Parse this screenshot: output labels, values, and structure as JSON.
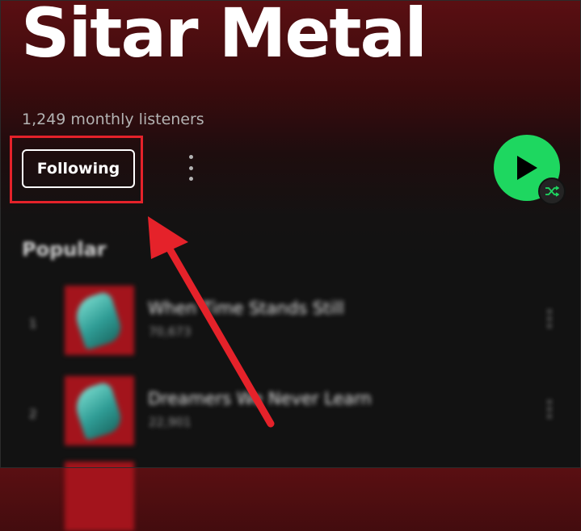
{
  "artist": {
    "name": "Sitar Metal",
    "monthly_listeners": "1,249 monthly listeners"
  },
  "actions": {
    "follow_label": "Following",
    "more_icon": "more-vertical-icon",
    "play_icon": "play-icon",
    "shuffle_icon": "shuffle-icon"
  },
  "popular": {
    "title": "Popular",
    "tracks": [
      {
        "number": "1",
        "title": "When Time Stands Still",
        "plays": "70,673"
      },
      {
        "number": "2",
        "title": "Dreamers We Never Learn",
        "plays": "22,901"
      }
    ]
  },
  "colors": {
    "accent_green": "#1ed760",
    "annotation_red": "#e5222a",
    "header_red": "#5a0f12",
    "background": "#121212"
  }
}
